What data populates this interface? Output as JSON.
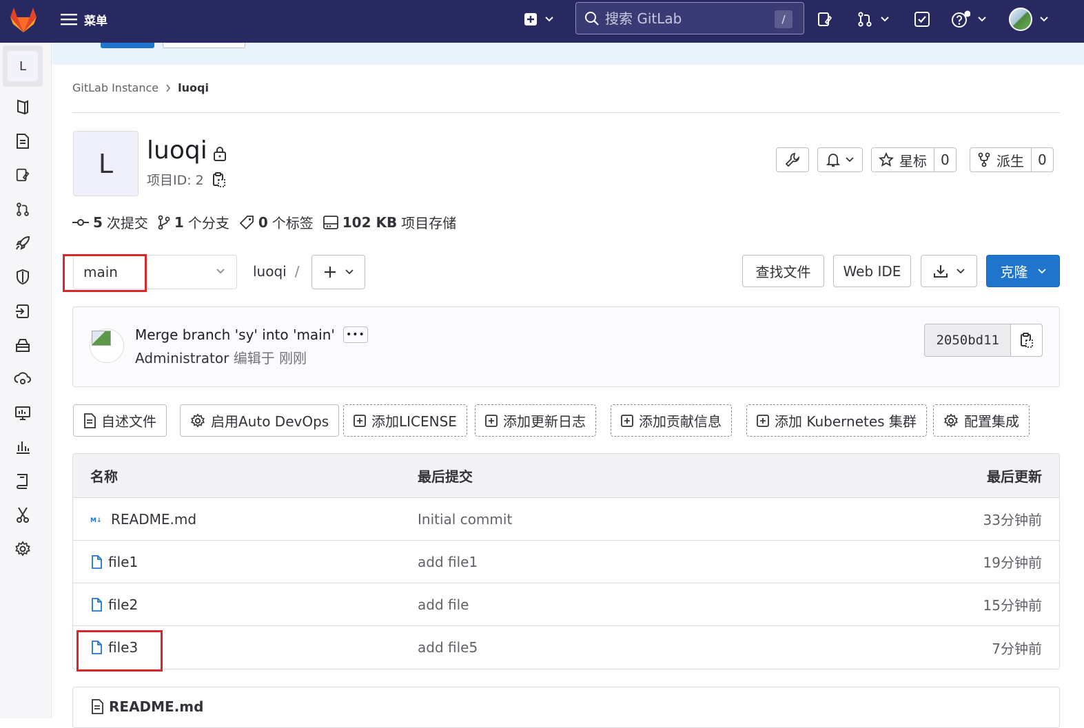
{
  "topbar": {
    "menu_label": "菜单",
    "search_placeholder": "搜索 GitLab",
    "search_shortcut": "/"
  },
  "sidebar": {
    "avatar_letter": "L",
    "items": [
      "project-overview",
      "repository",
      "issues",
      "merge-requests",
      "ci-cd",
      "security",
      "deployments",
      "packages",
      "infrastructure",
      "monitor",
      "analytics",
      "wiki",
      "snippets",
      "settings"
    ]
  },
  "breadcrumb": {
    "parent": "GitLab Instance",
    "current": "luoqi"
  },
  "project": {
    "avatar_letter": "L",
    "name": "luoqi",
    "id_label": "项目ID: 2",
    "star_label": "星标",
    "star_count": "0",
    "fork_label": "派生",
    "fork_count": "0"
  },
  "stats": {
    "commits_num": "5",
    "commits_label": "次提交",
    "branches_num": "1",
    "branches_label": "个分支",
    "tags_num": "0",
    "tags_label": "个标签",
    "storage_num": "102 KB",
    "storage_label": "项目存储"
  },
  "repo_nav": {
    "branch": "main",
    "path_root": "luoqi",
    "path_sep": "/",
    "find_file": "查找文件",
    "web_ide": "Web IDE",
    "clone": "克隆"
  },
  "last_commit": {
    "title": "Merge branch 'sy' into 'main'",
    "ellipsis": "•••",
    "author": "Administrator",
    "meta": "编辑于 刚刚",
    "sha": "2050bd11"
  },
  "quick_actions": [
    {
      "label": "自述文件"
    },
    {
      "label": "启用Auto DevOps"
    },
    {
      "label": "添加LICENSE"
    },
    {
      "label": "添加更新日志"
    },
    {
      "label": "添加贡献信息"
    },
    {
      "label": "添加 Kubernetes 集群"
    },
    {
      "label": "配置集成"
    }
  ],
  "file_table": {
    "headers": {
      "name": "名称",
      "commit": "最后提交",
      "updated": "最后更新"
    },
    "rows": [
      {
        "name": "README.md",
        "commit": "Initial commit",
        "updated": "33分钟前",
        "icon": "markdown-icon"
      },
      {
        "name": "file1",
        "commit": "add file1",
        "updated": "19分钟前",
        "icon": "file-icon"
      },
      {
        "name": "file2",
        "commit": "add file",
        "updated": "15分钟前",
        "icon": "file-icon"
      },
      {
        "name": "file3",
        "commit": "add file5",
        "updated": "7分钟前",
        "icon": "file-icon"
      }
    ]
  },
  "readme": {
    "title": "README.md"
  },
  "colors": {
    "topbar": "#292961",
    "primary": "#1f75cb",
    "annotation": "#d9262b"
  }
}
